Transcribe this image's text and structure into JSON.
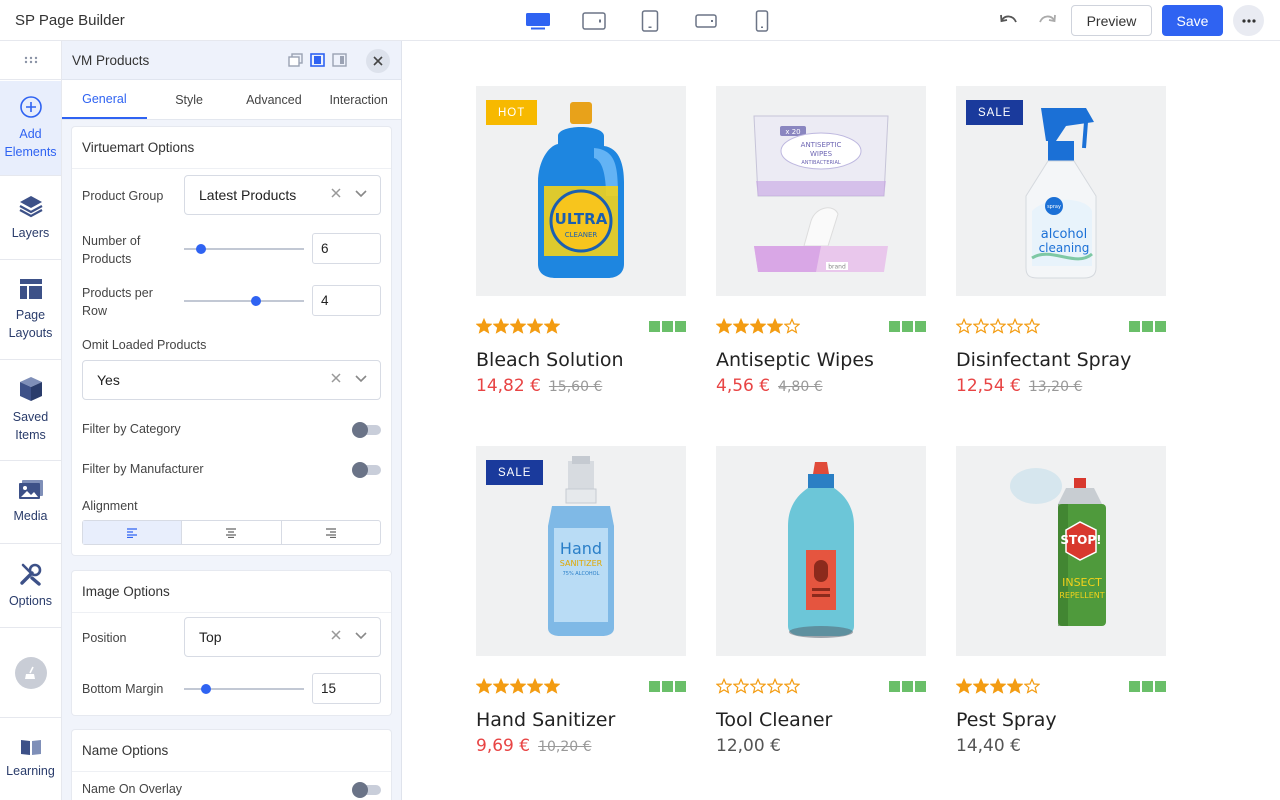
{
  "app": {
    "title": "SP Page Builder"
  },
  "toolbar": {
    "devices": [
      "desktop",
      "tablet-landscape",
      "tablet-portrait",
      "mobile-landscape",
      "mobile-portrait"
    ],
    "preview_label": "Preview",
    "save_label": "Save"
  },
  "rail": {
    "items": [
      {
        "label_line1": "Add",
        "label_line2": "Elements",
        "icon": "plus-circle-icon"
      },
      {
        "label_line1": "Layers",
        "label_line2": "",
        "icon": "layers-icon"
      },
      {
        "label_line1": "Page",
        "label_line2": "Layouts",
        "icon": "layout-icon"
      },
      {
        "label_line1": "Saved",
        "label_line2": "Items",
        "icon": "box-icon"
      },
      {
        "label_line1": "Media",
        "label_line2": "",
        "icon": "image-icon"
      },
      {
        "label_line1": "Options",
        "label_line2": "",
        "icon": "tools-icon"
      },
      {
        "label_line1": "Learning",
        "label_line2": "",
        "icon": "book-icon"
      }
    ]
  },
  "panel": {
    "title": "VM Products",
    "tabs": [
      "General",
      "Style",
      "Advanced",
      "Interaction"
    ],
    "active_tab": "General",
    "virtuemart": {
      "heading": "Virtuemart Options",
      "product_group_label": "Product Group",
      "product_group_value": "Latest Products",
      "num_products_label_1": "Number of",
      "num_products_label_2": "Products",
      "num_products_value": "6",
      "num_products_slider": 0.14,
      "per_row_label_1": "Products per",
      "per_row_label_2": "Row",
      "per_row_value": "4",
      "per_row_slider": 0.6,
      "omit_label": "Omit Loaded Products",
      "omit_value": "Yes",
      "filter_category_label": "Filter by Category",
      "filter_manufacturer_label": "Filter by Manufacturer",
      "alignment_label": "Alignment",
      "alignment_value": "left"
    },
    "image": {
      "heading": "Image Options",
      "position_label": "Position",
      "position_value": "Top",
      "bottom_margin_label": "Bottom Margin",
      "bottom_margin_value": "15",
      "bottom_margin_slider": 0.18
    },
    "name": {
      "heading": "Name Options",
      "on_overlay_label": "Name On Overlay"
    }
  },
  "products": [
    {
      "name": "Bleach Solution",
      "price": "14,82 €",
      "old_price": "15,60 €",
      "badge": "HOT",
      "rating": 5,
      "on_sale": true
    },
    {
      "name": "Antiseptic Wipes",
      "price": "4,56 €",
      "old_price": "4,80 €",
      "badge": "",
      "rating": 4,
      "on_sale": true
    },
    {
      "name": "Disinfectant Spray",
      "price": "12,54 €",
      "old_price": "13,20 €",
      "badge": "SALE",
      "rating": 0,
      "on_sale": true
    },
    {
      "name": "Hand Sanitizer",
      "price": "9,69 €",
      "old_price": "10,20 €",
      "badge": "SALE",
      "rating": 5,
      "on_sale": true
    },
    {
      "name": "Tool Cleaner",
      "price": "12,00 €",
      "old_price": "",
      "badge": "",
      "rating": 0,
      "on_sale": false
    },
    {
      "name": "Pest Spray",
      "price": "14,40 €",
      "old_price": "",
      "badge": "",
      "rating": 4,
      "on_sale": false
    }
  ],
  "colors": {
    "accent": "#2f63f2",
    "sale_price": "#e84444",
    "badge_hot": "#f7b900",
    "badge_sale": "#1a3a9c",
    "star": "#f39c12",
    "swatch": "#6abf69"
  },
  "product_art": {
    "bleach_label_1": "ULTRA",
    "bleach_label_2": "CLEANER",
    "wipes_count": "x 20",
    "wipes_label_1": "ANTISEPTIC",
    "wipes_label_2": "WIPES",
    "wipes_label_3": "ANTIBACTERIAL",
    "wipes_brand": "brand",
    "spray_brand": "spray",
    "spray_label_1": "alcohol",
    "spray_label_2": "cleaning",
    "sanitizer_label_1": "Hand",
    "sanitizer_label_2": "SANITIZER",
    "sanitizer_label_3": "75% ALCOHOL",
    "pest_label_1": "STOP!",
    "pest_label_2": "INSECT",
    "pest_label_3": "REPELLENT"
  }
}
